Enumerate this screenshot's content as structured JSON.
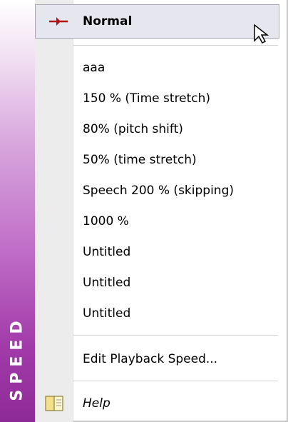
{
  "banner_text": "SPEED",
  "selected": {
    "label": "Normal"
  },
  "items": [
    {
      "label": "aaa"
    },
    {
      "label": "150 % (Time stretch)"
    },
    {
      "label": "80% (pitch shift)"
    },
    {
      "label": "50% (time stretch)"
    },
    {
      "label": "Speech 200 % (skipping)"
    },
    {
      "label": "1000 %"
    },
    {
      "label": "Untitled"
    },
    {
      "label": "Untitled"
    },
    {
      "label": "Untitled"
    }
  ],
  "edit_item": {
    "label": "Edit Playback Speed..."
  },
  "help_item": {
    "label": "Help"
  },
  "colors": {
    "accent": "#9a2f9f",
    "pin": "#b01414"
  },
  "icons": {
    "selected_marker": "pin-icon",
    "help": "help-book-icon",
    "cursor": "mouse-cursor-icon"
  }
}
